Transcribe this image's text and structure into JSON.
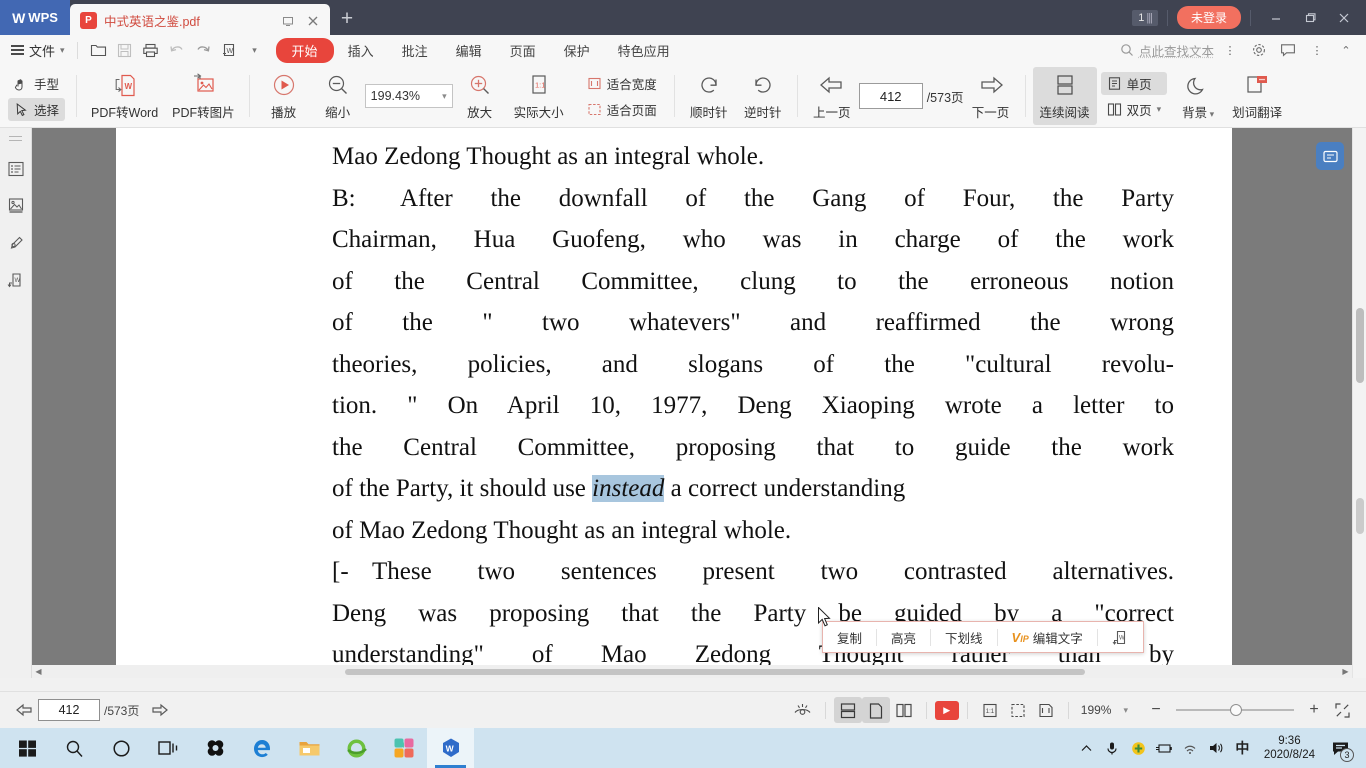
{
  "titlebar": {
    "app_name": "WPS",
    "tab_title": "中式英语之鉴.pdf",
    "tab_icon_letter": "P",
    "tab_restore_icon": "restore-icon",
    "tab_close_icon": "close-icon",
    "new_tab_icon": "plus-icon",
    "window_count": "1",
    "login_label": "未登录",
    "minimize_icon": "minimize-icon",
    "maximize_icon": "maximize-icon",
    "close_icon": "close-icon"
  },
  "menubar": {
    "file_label": "文件",
    "quick_icons": [
      "open-icon",
      "save-icon",
      "print-icon",
      "undo-icon",
      "redo-icon",
      "pdf-to-word-icon",
      "more-caret-icon"
    ],
    "tabs": [
      {
        "label": "开始",
        "active": true
      },
      {
        "label": "插入",
        "active": false
      },
      {
        "label": "批注",
        "active": false
      },
      {
        "label": "编辑",
        "active": false
      },
      {
        "label": "页面",
        "active": false
      },
      {
        "label": "保护",
        "active": false
      },
      {
        "label": "特色应用",
        "active": false
      }
    ],
    "search_placeholder": "点此查找文本",
    "right_icons": [
      "search-icon",
      "more-vertical-icon",
      "gear-icon",
      "feedback-icon",
      "more-vertical-icon",
      "collapse-ribbon-icon"
    ]
  },
  "ribbon": {
    "hand_tool": "手型",
    "select_tool": "选择",
    "pdf_to_word": "PDF转Word",
    "pdf_to_image": "PDF转图片",
    "play": "播放",
    "zoom_out": "缩小",
    "zoom_value": "199.43%",
    "zoom_in": "放大",
    "actual_size": "实际大小",
    "fit_width": "适合宽度",
    "fit_page": "适合页面",
    "rotate_cw": "顺时针",
    "rotate_ccw": "逆时针",
    "prev_page": "上一页",
    "page_number": "412",
    "page_total": "/573页",
    "next_page": "下一页",
    "continuous_read": "连续阅读",
    "single_page": "单页",
    "double_page": "双页",
    "background": "背景",
    "word_translate": "划词翻译"
  },
  "rail": {
    "items": [
      "outline-icon",
      "thumbnail-icon",
      "annotation-icon",
      "export-icon"
    ]
  },
  "document": {
    "float_button_icon": "floating-assistant-icon",
    "lines": [
      {
        "text": "Mao Zedong Thought as an integral whole.",
        "indent": true,
        "justify": false
      },
      {
        "marker": "B:",
        "text": "After the downfall of the Gang of Four, the Party",
        "justify": true
      },
      {
        "text": "Chairman, Hua Guofeng, who was in charge of the work",
        "indent": true,
        "justify": true
      },
      {
        "text": "of the Central Committee, clung to the erroneous notion",
        "indent": true,
        "justify": true
      },
      {
        "text": "of the \" two whatevers\" and reaffirmed the wrong",
        "indent": true,
        "justify": true
      },
      {
        "text": "theories, policies, and slogans of the \"cultural revolu-",
        "indent": true,
        "justify": true
      },
      {
        "text": "tion. \" On April 10, 1977, Deng Xiaoping wrote a letter to",
        "indent": true,
        "justify": true
      },
      {
        "text": "the Central Committee, proposing that to guide the work",
        "indent": true,
        "justify": true
      },
      {
        "text": "of the Party, it should use ",
        "selection": "instead",
        "text_after": " a correct understanding",
        "indent": true,
        "justify": true
      },
      {
        "text": "of Mao Zedong Thought as an integral whole.",
        "indent": true,
        "justify": false
      },
      {
        "marker": "[-",
        "text": "These two sentences present two contrasted alternatives.",
        "justify": true
      },
      {
        "text": "Deng was proposing that the Party be guided by a \"correct",
        "indent": true,
        "justify": true
      },
      {
        "text": "understanding\" of Mao Zedong Thought rather than by",
        "indent": true,
        "justify": true
      }
    ],
    "selected_text": "instead"
  },
  "context_menu": {
    "items": [
      {
        "label": "复制",
        "icon": null
      },
      {
        "label": "高亮",
        "icon": null
      },
      {
        "label": "下划线",
        "icon": null
      },
      {
        "label": "编辑文字",
        "icon": "vip-badge"
      },
      {
        "label": "",
        "icon": "export-to-word-icon"
      }
    ],
    "vip_text": "V",
    "vip_sub": "IP"
  },
  "statusbar": {
    "prev_icon": "prev-page-arrow-icon",
    "page_number": "412",
    "page_total": "/573页",
    "next_icon": "next-page-arrow-icon",
    "eye_icon": "eye-protect-icon",
    "view_icons": [
      "continuous-read-icon",
      "single-page-icon",
      "double-page-icon"
    ],
    "play_icon": "play-icon",
    "size_icons": [
      "actual-size-icon",
      "fit-page-icon",
      "fit-width-icon"
    ],
    "zoom_value": "199%",
    "zoom_caret": "chevron-down-icon",
    "minus": "−",
    "plus": "+",
    "fullscreen_icon": "fullscreen-icon"
  },
  "taskbar": {
    "items": [
      {
        "name": "start-button",
        "icon": "windows-logo"
      },
      {
        "name": "search-button",
        "icon": "search-icon"
      },
      {
        "name": "cortana-button",
        "icon": "circle-icon"
      },
      {
        "name": "task-view-button",
        "icon": "task-view-icon"
      },
      {
        "name": "app-snipaste",
        "icon": "snipaste-icon"
      },
      {
        "name": "app-edge",
        "icon": "edge-icon"
      },
      {
        "name": "app-file-explorer",
        "icon": "folder-icon"
      },
      {
        "name": "app-ie-browser",
        "icon": "explorer-icon"
      },
      {
        "name": "app-photos",
        "icon": "photos-icon"
      },
      {
        "name": "app-wps",
        "icon": "wps-icon",
        "active": true
      }
    ],
    "tray": [
      {
        "name": "show-hidden-icons",
        "icon": "chevron-up-icon"
      },
      {
        "name": "microphone-icon",
        "icon": "mic-icon"
      },
      {
        "name": "security-shield-icon",
        "icon": "shield-icon"
      },
      {
        "name": "battery-saver-icon",
        "icon": "battery-icon"
      },
      {
        "name": "wifi-icon",
        "icon": "wifi-icon"
      },
      {
        "name": "volume-icon",
        "icon": "speaker-icon"
      },
      {
        "name": "ime-indicator",
        "icon": "中"
      }
    ],
    "time": "9:36",
    "date": "2020/8/24",
    "notification_count": "3"
  },
  "colors": {
    "titlebar_bg": "#3f4351",
    "accent_red": "#e8453c",
    "login_btn": "#f2705f",
    "selection_blue": "#a8c6de",
    "taskbar_bg": "#cfe3f0",
    "wps_blue": "#4268b3"
  }
}
